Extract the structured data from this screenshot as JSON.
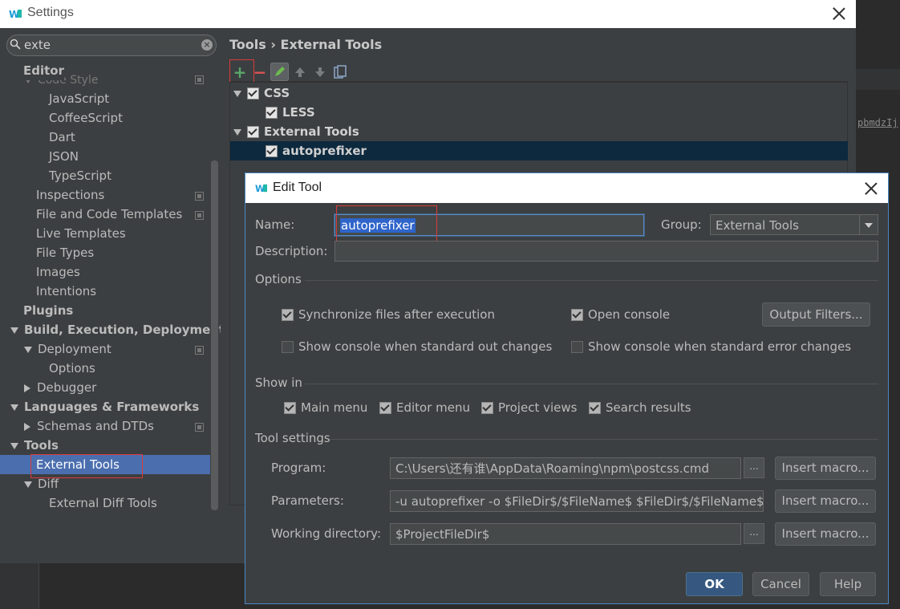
{
  "settings_window": {
    "title": "Settings",
    "search": {
      "value": "exte"
    },
    "breadcrumb": "Tools › External Tools",
    "tree": {
      "editor": "Editor",
      "code_style": "Code Style",
      "javascript": "JavaScript",
      "coffeescript": "CoffeeScript",
      "dart": "Dart",
      "json": "JSON",
      "typescript": "TypeScript",
      "inspections": "Inspections",
      "file_code_templates": "File and Code Templates",
      "live_templates": "Live Templates",
      "file_types": "File Types",
      "images": "Images",
      "intentions": "Intentions",
      "plugins": "Plugins",
      "build": "Build, Execution, Deployment",
      "deployment": "Deployment",
      "options": "Options",
      "debugger": "Debugger",
      "languages": "Languages & Frameworks",
      "schemas": "Schemas and DTDs",
      "tools": "Tools",
      "external_tools": "External Tools",
      "diff": "Diff",
      "external_diff_tools": "External Diff Tools"
    },
    "toolbar": {
      "add": "+",
      "remove": "−"
    },
    "tools_tree": {
      "css": "CSS",
      "less": "LESS",
      "external_tools": "External Tools",
      "autoprefixer": "autoprefixer"
    },
    "background_text": "pbmdzIj"
  },
  "edit_tool": {
    "title": "Edit Tool",
    "name_label": "Name:",
    "name_value": "autoprefixer",
    "group_label": "Group:",
    "group_value": "External Tools",
    "description_label": "Description:",
    "description_value": "",
    "options_header": "Options",
    "sync_files": "Synchronize files after execution",
    "open_console": "Open console",
    "output_filters": "Output Filters...",
    "show_console_out": "Show console when standard out changes",
    "show_console_err": "Show console when standard error changes",
    "show_in_header": "Show in",
    "main_menu": "Main menu",
    "editor_menu": "Editor menu",
    "project_views": "Project views",
    "search_results": "Search results",
    "tool_settings_header": "Tool settings",
    "program_label": "Program:",
    "program_value": "C:\\Users\\还有谁\\AppData\\Roaming\\npm\\postcss.cmd",
    "parameters_label": "Parameters:",
    "parameters_value": "-u autoprefixer -o $FileDir$/$FileName$  $FileDir$/$FileName$",
    "working_dir_label": "Working directory:",
    "working_dir_value": "$ProjectFileDir$",
    "insert_macro": "Insert macro...",
    "dots": "...",
    "ok": "OK",
    "cancel": "Cancel",
    "help": "Help"
  }
}
